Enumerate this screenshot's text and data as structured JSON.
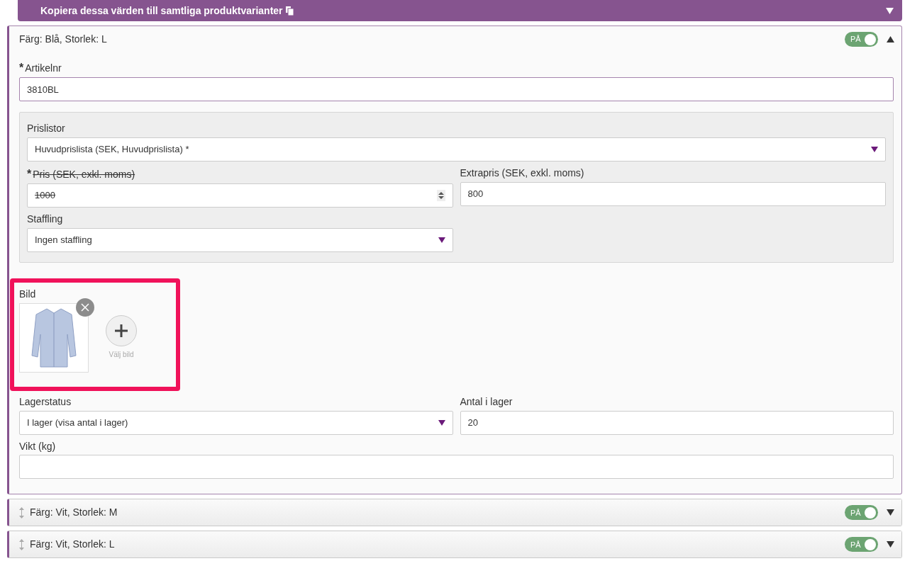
{
  "copy_bar": {
    "label": "Kopiera dessa värden till samtliga produktvarianter",
    "expanded": false
  },
  "variants": [
    {
      "title": "Färg: Blå, Storlek: L",
      "expanded": true,
      "on": true,
      "toggle_label": "PÅ",
      "details": {
        "article": {
          "label": "Artikelnr",
          "required_mark": "*",
          "value": "3810BL"
        },
        "price_panel": {
          "pricelist": {
            "label": "Prislistor",
            "value": "Huvudprislista (SEK, Huvudprislista) *"
          },
          "price": {
            "label": "Pris (SEK, exkl. moms)",
            "required_mark": "*",
            "struck": true,
            "value": "1000"
          },
          "extra_price": {
            "label": "Extrapris (SEK, exkl. moms)",
            "value": "800"
          },
          "tiering": {
            "label": "Staffling",
            "value": "Ingen staffling"
          }
        },
        "image": {
          "label": "Bild",
          "highlighted": true,
          "add_label": "Välj bild"
        },
        "stock_status": {
          "label": "Lagerstatus",
          "value": "I lager (visa antal i lager)"
        },
        "stock_count": {
          "label": "Antal i lager",
          "value": "20"
        },
        "weight": {
          "label": "Vikt (kg)"
        }
      }
    },
    {
      "title": "Färg: Vit, Storlek: M",
      "expanded": false,
      "on": true,
      "toggle_label": "PÅ"
    },
    {
      "title": "Färg: Vit, Storlek: L",
      "expanded": false,
      "on": true,
      "toggle_label": "PÅ"
    }
  ]
}
